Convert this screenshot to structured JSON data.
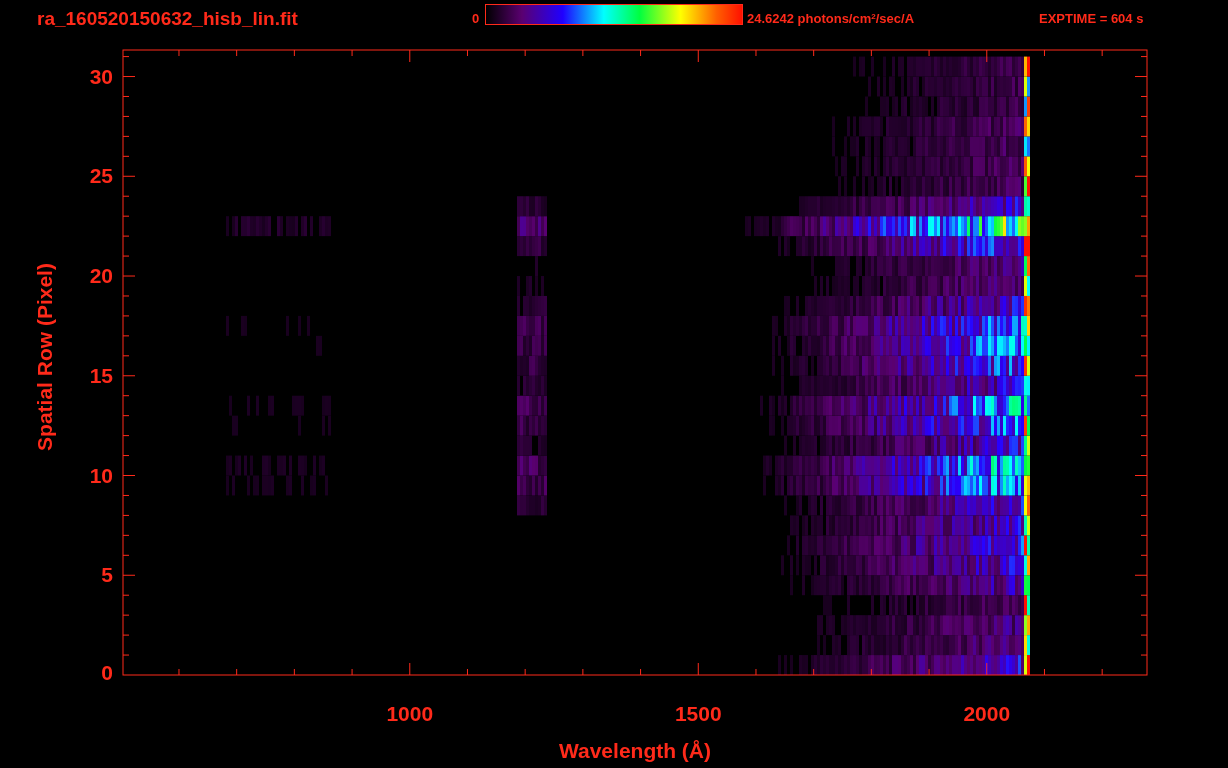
{
  "header": {
    "file_name": "ra_160520150632_hisb_lin.fit",
    "colorbar": {
      "min_label": "0",
      "max_label": "24.6242 photons/cm$^{2}$/sec/A"
    },
    "exposure": "EXPTIME = 604 s"
  },
  "plot": {
    "xlabel": "Wavelength (Å)",
    "ylabel": "Spatial Row (Pixel)",
    "xticks": [
      "1000",
      "1500",
      "2000"
    ],
    "yticks": [
      "30",
      "25",
      "20",
      "15",
      "10",
      "5",
      "0"
    ]
  }
}
